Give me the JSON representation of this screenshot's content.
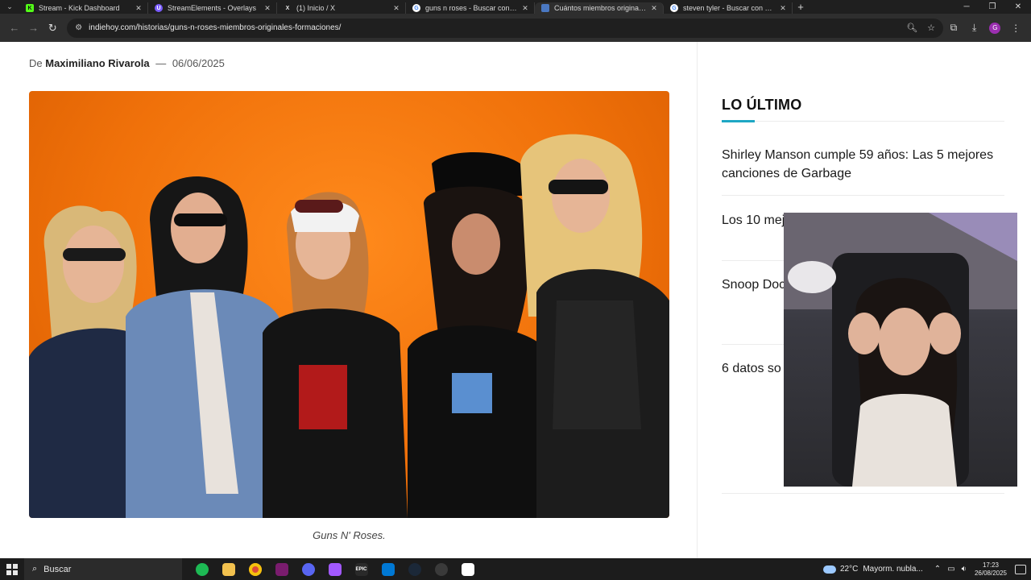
{
  "browser": {
    "tabs": [
      {
        "title": "Stream - Kick Dashboard",
        "favicon_color": "#53fc18",
        "favicon_text": "K",
        "active": false
      },
      {
        "title": "StreamElements - Overlays",
        "favicon_color": "#7a5cff",
        "favicon_text": "U",
        "active": false
      },
      {
        "title": "(1) Inicio / X",
        "favicon_color": "#1f1f1f",
        "favicon_text": "X",
        "active": false
      },
      {
        "title": "guns n roses - Buscar con Goog",
        "favicon_color": "#ffffff",
        "favicon_text": "G",
        "active": false
      },
      {
        "title": "Cuántos miembros originales q",
        "favicon_color": "#4a78c2",
        "favicon_text": "",
        "active": true
      },
      {
        "title": "steven tyler - Buscar con Goog",
        "favicon_color": "#ffffff",
        "favicon_text": "G",
        "active": false
      }
    ],
    "address": "indiehoy.com/historias/guns-n-roses-miembros-originales-formaciones/",
    "profile_initial": "G"
  },
  "article": {
    "byline_prefix": "De",
    "author": "Maximiliano Rivarola",
    "byline_sep": "—",
    "date": "06/06/2025",
    "image_caption": "Guns N' Roses."
  },
  "sidebar": {
    "heading": "LO ÚLTIMO",
    "accent_color": "#1ea7c4",
    "items": [
      {
        "title": "Shirley Manson cumple 59 años: Las 5 mejores canciones de Garbage"
      },
      {
        "title": "Los 10 mej especialist"
      },
      {
        "title": "Snoop Doc LGBTQ+ en polémica"
      },
      {
        "title": "6 datos so persecució"
      }
    ]
  },
  "taskbar": {
    "search_label": "Buscar",
    "weather_temp": "22°C",
    "weather_text": "Mayorm. nubla...",
    "time": "17:23",
    "date": "26/08/2025",
    "apps": [
      {
        "name": "spotify",
        "color": "#1db954",
        "glyph": ""
      },
      {
        "name": "file-explorer",
        "color": "#f2c14e",
        "glyph": ""
      },
      {
        "name": "chrome",
        "color": "#dd4b39",
        "glyph": ""
      },
      {
        "name": "obs",
        "color": "#7a1c6e",
        "glyph": ""
      },
      {
        "name": "discord",
        "color": "#5865f2",
        "glyph": ""
      },
      {
        "name": "figma",
        "color": "#a259ff",
        "glyph": ""
      },
      {
        "name": "epic-games",
        "color": "#2a2a2a",
        "glyph": "EPIC"
      },
      {
        "name": "vs-code",
        "color": "#0078d4",
        "glyph": ""
      },
      {
        "name": "steam",
        "color": "#1b2838",
        "glyph": ""
      },
      {
        "name": "obs-studio",
        "color": "#3a3a3a",
        "glyph": ""
      },
      {
        "name": "capcut",
        "color": "#ffffff",
        "glyph": ""
      }
    ]
  }
}
